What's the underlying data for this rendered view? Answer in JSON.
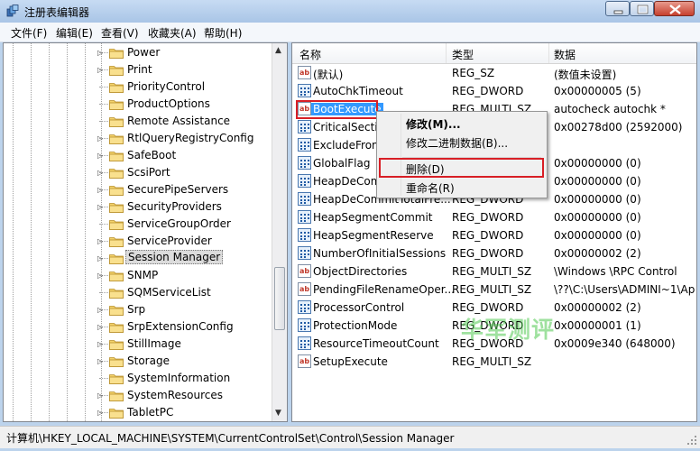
{
  "window": {
    "title": "注册表编辑器",
    "accent_color": "#3399ff",
    "highlight_color": "#d81f26"
  },
  "menu": [
    {
      "label": "文件(F)"
    },
    {
      "label": "编辑(E)"
    },
    {
      "label": "查看(V)"
    },
    {
      "label": "收藏夹(A)"
    },
    {
      "label": "帮助(H)"
    }
  ],
  "tree": {
    "items": [
      {
        "label": "Power",
        "expandable": true
      },
      {
        "label": "Print",
        "expandable": true
      },
      {
        "label": "PriorityControl",
        "expandable": false
      },
      {
        "label": "ProductOptions",
        "expandable": false
      },
      {
        "label": "Remote Assistance",
        "expandable": false
      },
      {
        "label": "RtlQueryRegistryConfig",
        "expandable": true
      },
      {
        "label": "SafeBoot",
        "expandable": true
      },
      {
        "label": "ScsiPort",
        "expandable": true
      },
      {
        "label": "SecurePipeServers",
        "expandable": true
      },
      {
        "label": "SecurityProviders",
        "expandable": true
      },
      {
        "label": "ServiceGroupOrder",
        "expandable": false
      },
      {
        "label": "ServiceProvider",
        "expandable": true
      },
      {
        "label": "Session Manager",
        "expandable": true,
        "selected": true
      },
      {
        "label": "SNMP",
        "expandable": true
      },
      {
        "label": "SQMServiceList",
        "expandable": false
      },
      {
        "label": "Srp",
        "expandable": true
      },
      {
        "label": "SrpExtensionConfig",
        "expandable": true
      },
      {
        "label": "StillImage",
        "expandable": true
      },
      {
        "label": "Storage",
        "expandable": true
      },
      {
        "label": "SystemInformation",
        "expandable": false
      },
      {
        "label": "SystemResources",
        "expandable": true
      },
      {
        "label": "TabletPC",
        "expandable": true
      }
    ]
  },
  "list": {
    "columns": {
      "name": "名称",
      "type": "类型",
      "data": "数据"
    },
    "rows": [
      {
        "name": "(默认)",
        "type": "REG_SZ",
        "data": "(数值未设置)",
        "icon": "string-value-icon"
      },
      {
        "name": "AutoChkTimeout",
        "type": "REG_DWORD",
        "data": "0x00000005 (5)",
        "icon": "binary-value-icon"
      },
      {
        "name": "BootExecute",
        "type": "REG_MULTI_SZ",
        "data": "autocheck autochk *",
        "icon": "string-value-icon",
        "selected": true
      },
      {
        "name": "CriticalSectio",
        "type": "",
        "data": "0x00278d00 (2592000)",
        "icon": "binary-value-icon"
      },
      {
        "name": "ExcludeFrom",
        "type": "",
        "data": "",
        "icon": "binary-value-icon"
      },
      {
        "name": "GlobalFlag",
        "type": "",
        "data": "0x00000000 (0)",
        "icon": "binary-value-icon"
      },
      {
        "name": "HeapDeCom",
        "type": "",
        "data": "0x00000000 (0)",
        "icon": "binary-value-icon"
      },
      {
        "name": "HeapDeCommitTotalFre...",
        "type": "REG_DWORD",
        "data": "0x00000000 (0)",
        "icon": "binary-value-icon"
      },
      {
        "name": "HeapSegmentCommit",
        "type": "REG_DWORD",
        "data": "0x00000000 (0)",
        "icon": "binary-value-icon"
      },
      {
        "name": "HeapSegmentReserve",
        "type": "REG_DWORD",
        "data": "0x00000000 (0)",
        "icon": "binary-value-icon"
      },
      {
        "name": "NumberOfInitialSessions",
        "type": "REG_DWORD",
        "data": "0x00000002 (2)",
        "icon": "binary-value-icon"
      },
      {
        "name": "ObjectDirectories",
        "type": "REG_MULTI_SZ",
        "data": "\\Windows \\RPC Control",
        "icon": "string-value-icon"
      },
      {
        "name": "PendingFileRenameOper...",
        "type": "REG_MULTI_SZ",
        "data": "\\??\\C:\\Users\\ADMINI~1\\Ap",
        "icon": "string-value-icon"
      },
      {
        "name": "ProcessorControl",
        "type": "REG_DWORD",
        "data": "0x00000002 (2)",
        "icon": "binary-value-icon"
      },
      {
        "name": "ProtectionMode",
        "type": "REG_DWORD",
        "data": "0x00000001 (1)",
        "icon": "binary-value-icon"
      },
      {
        "name": "ResourceTimeoutCount",
        "type": "REG_DWORD",
        "data": "0x0009e340 (648000)",
        "icon": "binary-value-icon"
      },
      {
        "name": "SetupExecute",
        "type": "REG_MULTI_SZ",
        "data": "",
        "icon": "string-value-icon"
      }
    ]
  },
  "context_menu": {
    "modify": "修改(M)...",
    "modify_binary": "修改二进制数据(B)...",
    "delete": "删除(D)",
    "rename": "重命名(R)"
  },
  "status_bar": {
    "path": "计算机\\HKEY_LOCAL_MACHINE\\SYSTEM\\CurrentControlSet\\Control\\Session Manager"
  },
  "watermark": "华军测评"
}
